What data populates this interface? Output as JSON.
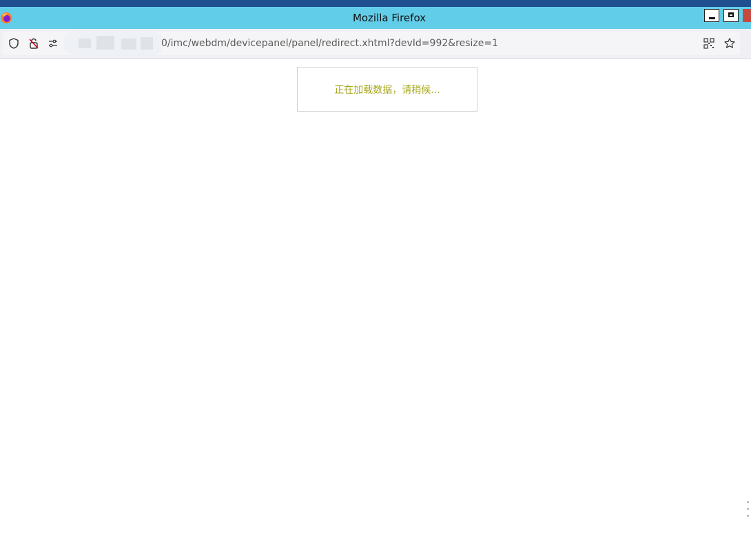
{
  "window": {
    "title": "Mozilla Firefox"
  },
  "navbar": {
    "url_text": "0/imc/webdm/devicepanel/panel/redirect.xhtml?devId=992&resize=1",
    "icons": [
      "shield-icon",
      "lock-off-icon",
      "permissions-icon",
      "qr-code-icon",
      "bookmark-star-icon"
    ]
  },
  "page": {
    "loading_message": "正在加载数据，请稍候..."
  },
  "colors": {
    "titlebar": "#62cde8",
    "top_strip": "#1f4f8f",
    "loading_text": "#a8a81e",
    "close_button": "#c74a40"
  }
}
